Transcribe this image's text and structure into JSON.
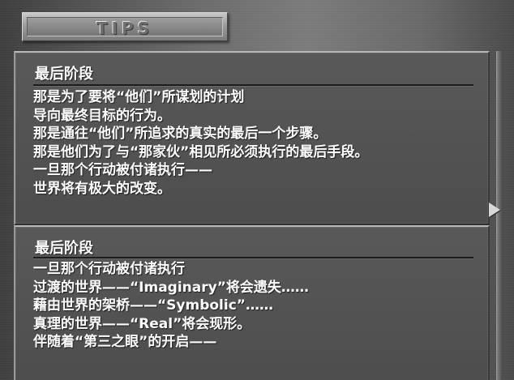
{
  "title": "TIPS",
  "panels": [
    {
      "heading": "最后阶段",
      "lines": [
        "那是为了要将“他们”所谋划的计划",
        "导向最终目标的行为。",
        "那是通往“他们”所追求的真实的最后一个步骤。",
        "那是他们为了与“那家伙”相见所必须执行的最后手段。",
        "一旦那个行动被付诸执行——",
        "世界将有极大的改变。"
      ]
    },
    {
      "heading": "最后阶段",
      "lines": [
        "一旦那个行动被付诸执行",
        "过渡的世界——“Imaginary”将会遗失……",
        "藉由世界的架桥——“Symbolic”……",
        "真理的世界——“Real”将会现形。",
        "伴随着“第三之眼”的开启——"
      ]
    }
  ],
  "scroll_indicator_icon": "right-triangle-arrow",
  "colors": {
    "text": "#ffffff",
    "panel": "#555555",
    "title_plate": "#9a9a9a"
  }
}
